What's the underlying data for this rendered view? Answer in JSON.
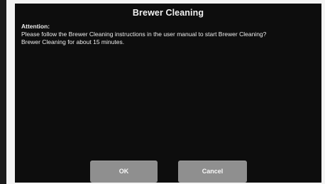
{
  "dialog": {
    "title": "Brewer Cleaning",
    "message_lines": [
      "Attention:",
      "Please follow the Brewer Cleaning instructions in the user manual to start Brewer Cleaning?",
      "Brewer Cleaning for about 15 minutes."
    ],
    "ok_label": "OK",
    "cancel_label": "Cancel"
  },
  "colors": {
    "panel_background": "#0d0d0d",
    "button_background": "#8f8f8f",
    "text": "#f2f2f2"
  }
}
